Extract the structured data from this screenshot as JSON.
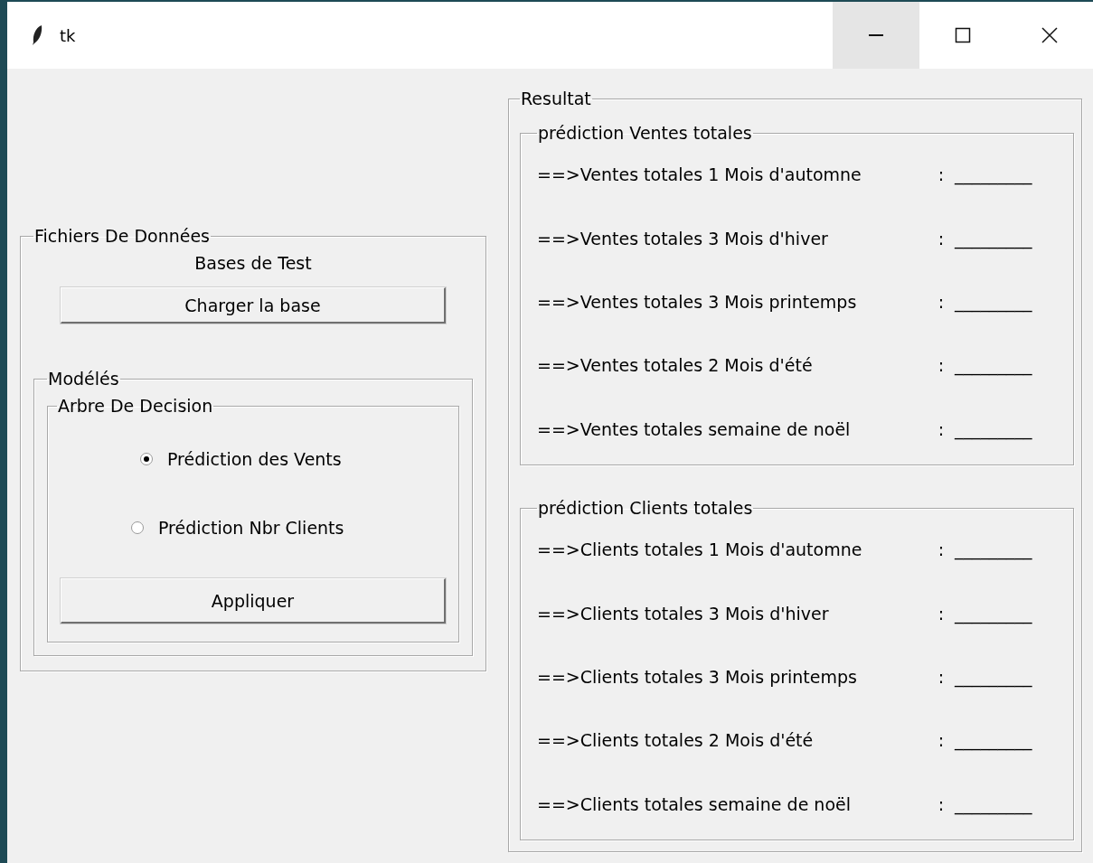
{
  "window": {
    "title": "tk"
  },
  "files_frame": {
    "title": "Fichiers De Données",
    "subtitle": "Bases de Test",
    "load_button": "Charger la base",
    "models_frame": {
      "title": "Modélés",
      "tree_frame": {
        "title": "Arbre De Decision",
        "options": [
          {
            "label": "Prédiction des Vents",
            "selected": true
          },
          {
            "label": "Prédiction Nbr Clients",
            "selected": false
          }
        ],
        "apply_button": "Appliquer"
      }
    }
  },
  "result_frame": {
    "title": "Resultat",
    "groups": [
      {
        "title": "prédiction Ventes totales",
        "rows": [
          {
            "label": "==>Ventes totales 1 Mois d'automne",
            "sep": ":",
            "value": "_________"
          },
          {
            "label": "==>Ventes totales 3 Mois d'hiver",
            "sep": ":",
            "value": "_________"
          },
          {
            "label": "==>Ventes totales 3 Mois printemps",
            "sep": ":",
            "value": "_________"
          },
          {
            "label": "==>Ventes totales 2 Mois d'été",
            "sep": ":",
            "value": "_________"
          },
          {
            "label": "==>Ventes totales semaine de noël",
            "sep": ":",
            "value": "_________"
          }
        ]
      },
      {
        "title": "prédiction Clients totales",
        "rows": [
          {
            "label": "==>Clients totales 1 Mois d'automne",
            "sep": ":",
            "value": "_________"
          },
          {
            "label": "==>Clients totales 3 Mois d'hiver",
            "sep": ":",
            "value": "_________"
          },
          {
            "label": "==>Clients totales 3 Mois printemps",
            "sep": ":",
            "value": "_________"
          },
          {
            "label": "==>Clients totales 2 Mois d'été",
            "sep": ":",
            "value": "_________"
          },
          {
            "label": "==>Clients totales semaine de noël",
            "sep": ":",
            "value": "_________"
          }
        ]
      }
    ]
  }
}
